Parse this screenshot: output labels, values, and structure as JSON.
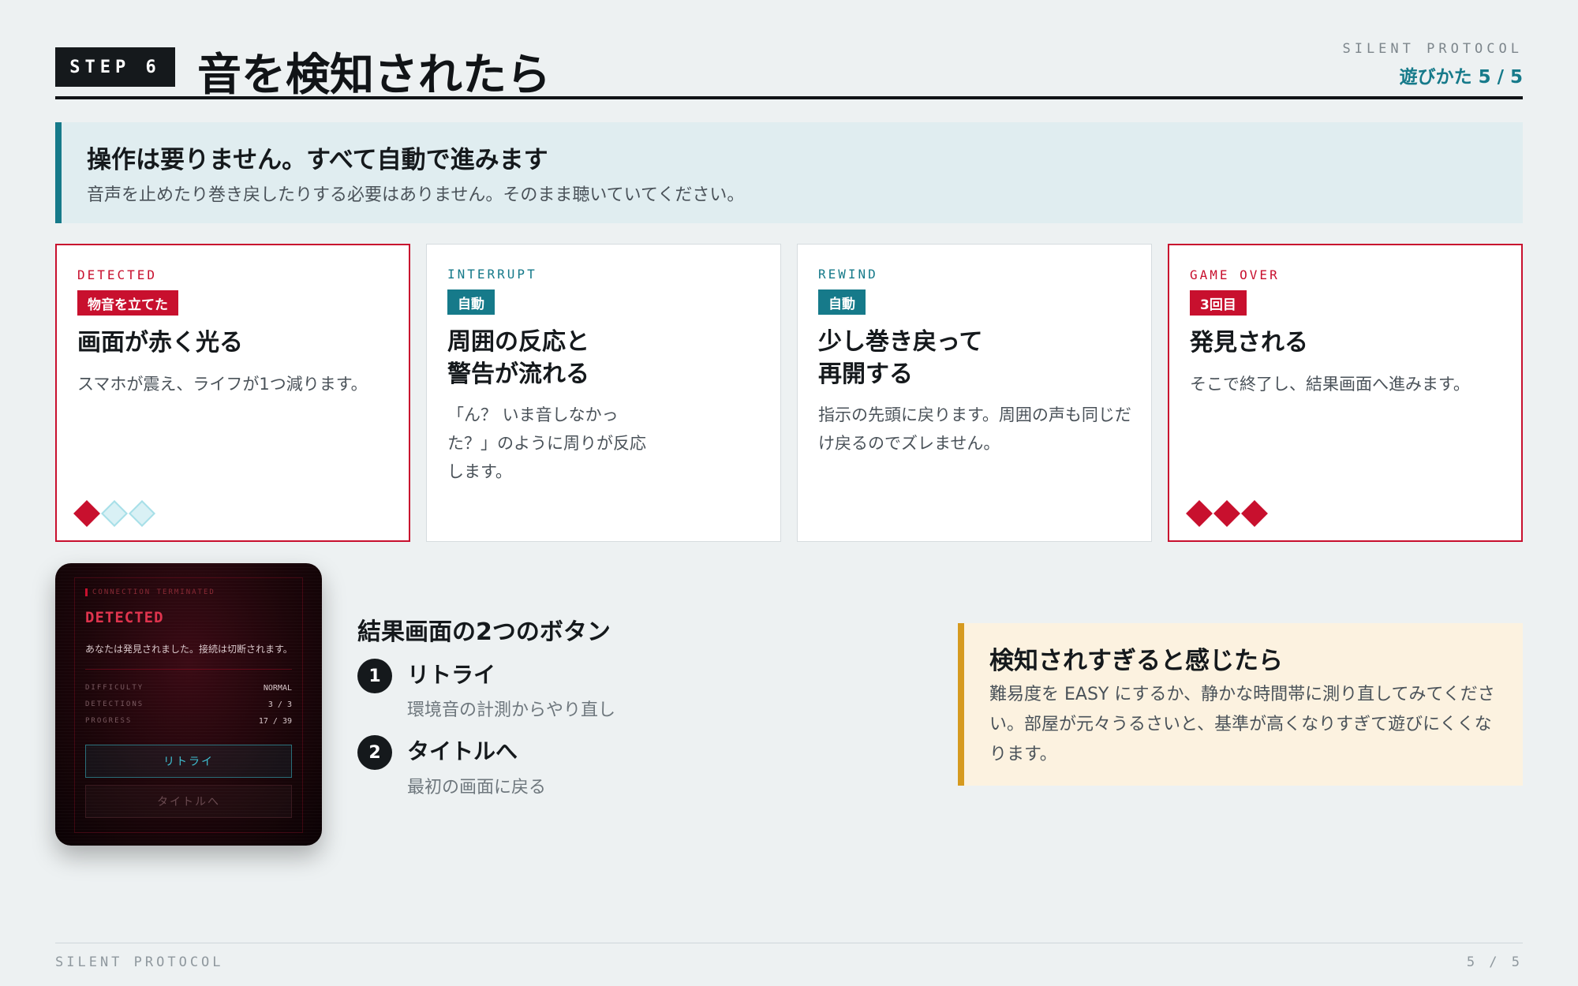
{
  "header": {
    "step_label": "STEP 6",
    "title": "音を検知されたら",
    "brand": "SILENT PROTOCOL",
    "howto": "遊びかた 5 / 5"
  },
  "banner": {
    "title": "操作は要りません。すべて自動で進みます",
    "text": "音声を止めたり巻き戻したりする必要はありません。そのまま聴いていてください。"
  },
  "cards": [
    {
      "code": "DETECTED",
      "badge": "物音を立てた",
      "title_lines": [
        "画面が赤く光る"
      ],
      "desc": "スマホが震え、ライフが1つ減ります。",
      "lives_lost": 1,
      "lives_total": 3
    },
    {
      "code": "INTERRUPT",
      "badge": "自動",
      "title_lines": [
        "周囲の反応と",
        "警告が流れる"
      ],
      "desc": "「ん？ いま音しなかった？」のように周りが反応します。"
    },
    {
      "code": "REWIND",
      "badge": "自動",
      "title_lines": [
        "少し巻き戻って",
        "再開する"
      ],
      "desc": "指示の先頭に戻ります。周囲の声も同じだけ戻るのでズレません。"
    },
    {
      "code": "GAME OVER",
      "badge": "3回目",
      "title_lines": [
        "発見される"
      ],
      "desc": "そこで終了し、結果画面へ進みます。",
      "lives_lost": 3,
      "lives_total": 3
    }
  ],
  "phone": {
    "connection": "CONNECTION TERMINATED",
    "detected": "DETECTED",
    "message": "あなたは発見されました。接続は切断されます。",
    "stats": [
      {
        "label": "DIFFICULTY",
        "value": "NORMAL"
      },
      {
        "label": "DETECTIONS",
        "value": "3 / 3"
      },
      {
        "label": "PROGRESS",
        "value": "17 / 39"
      }
    ],
    "retry": "リトライ",
    "title_btn": "タイトルへ"
  },
  "results": {
    "title": "結果画面の2つのボタン",
    "options": [
      {
        "num": "1",
        "label": "リトライ",
        "desc": "環境音の計測からやり直し"
      },
      {
        "num": "2",
        "label": "タイトルへ",
        "desc": "最初の画面に戻る"
      }
    ]
  },
  "tip": {
    "title": "検知されすぎると感じたら",
    "text": "難易度を EASY にするか、静かな時間帯に測り直してみてください。部屋が元々うるさいと、基準が高くなりすぎて遊びにくくなります。"
  },
  "footer": {
    "brand": "SILENT PROTOCOL",
    "page": "5 / 5"
  },
  "colors": {
    "accent": "#167a8a",
    "danger": "#c8102e",
    "warning": "#d69a1f"
  }
}
